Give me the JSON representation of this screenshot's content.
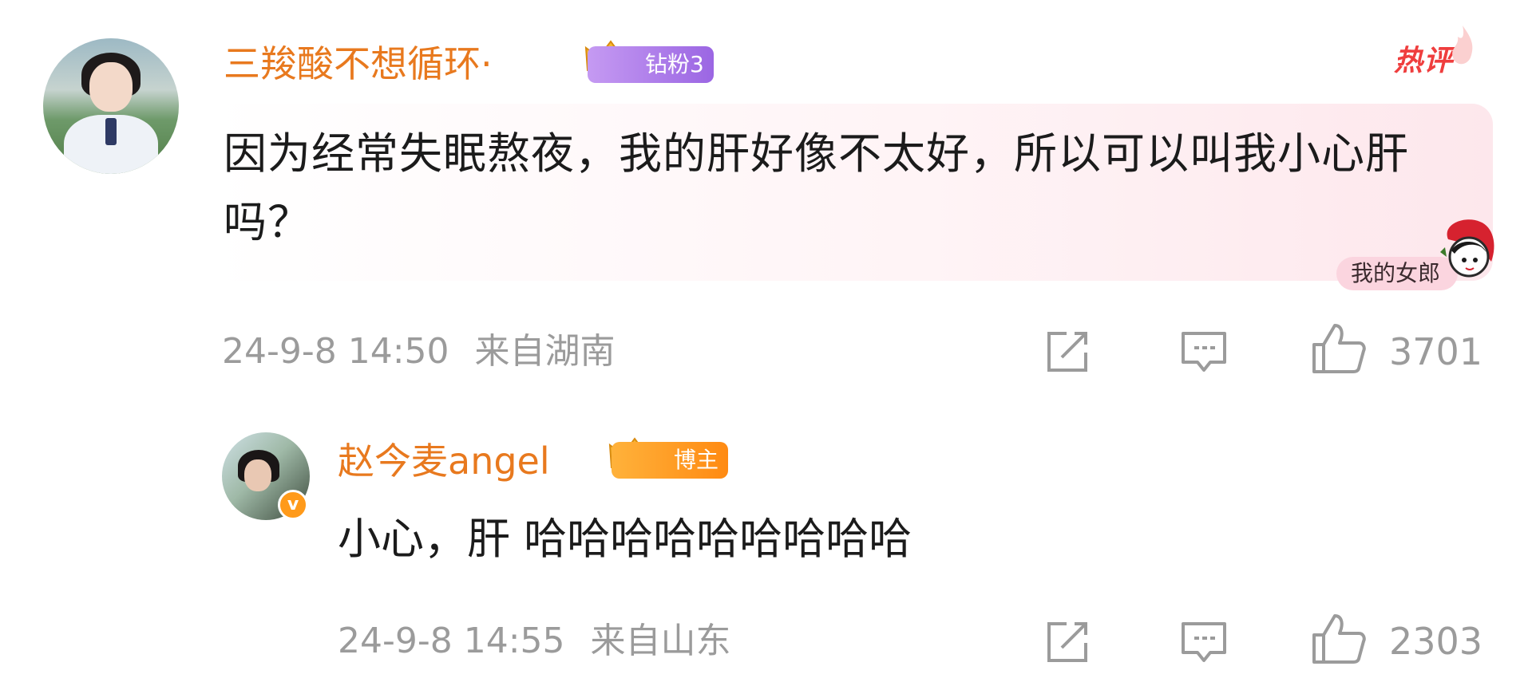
{
  "comment": {
    "username": "三羧酸不想循环·",
    "badge_label": "钻粉3",
    "hot_tag": "热评",
    "text": "因为经常失眠熬夜，我的肝好像不太好，所以可以叫我小心肝吗？",
    "decoration_label": "我的女郎",
    "timestamp": "24-9-8 14:50",
    "location": "来自湖南",
    "like_count": "3701"
  },
  "reply": {
    "username": "赵今麦angel",
    "badge_label": "博主",
    "verified_glyph": "v",
    "text": "小心，肝 哈哈哈哈哈哈哈哈哈",
    "timestamp": "24-9-8 14:55",
    "location": "来自山东",
    "like_count": "2303"
  },
  "icons": {
    "share": "share-icon",
    "comment": "comment-icon",
    "like": "thumbs-up-icon"
  },
  "colors": {
    "username": "#e8791e",
    "hot_tag": "#ef3e3e",
    "meta_text": "#9b9b9b",
    "fan_badge_purple": "#9b66e3",
    "fan_badge_orange": "#ff8a12"
  }
}
